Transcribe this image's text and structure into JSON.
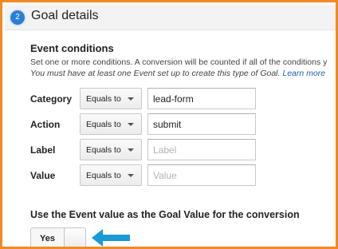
{
  "header": {
    "step_number": "2",
    "title": "Goal details"
  },
  "event_conditions": {
    "title": "Event conditions",
    "description": "Set one or more conditions. A conversion will be counted if all of the conditions y",
    "requirement": "You must have at least one Event set up to create this type of Goal.",
    "learn_more": "Learn more"
  },
  "conditions": [
    {
      "label": "Category",
      "operator": "Equals to",
      "value": "lead-form",
      "placeholder": ""
    },
    {
      "label": "Action",
      "operator": "Equals to",
      "value": "submit",
      "placeholder": ""
    },
    {
      "label": "Label",
      "operator": "Equals to",
      "value": "",
      "placeholder": "Label"
    },
    {
      "label": "Value",
      "operator": "Equals to",
      "value": "",
      "placeholder": "Value"
    }
  ],
  "goal_value": {
    "label": "Use the Event value as the Goal Value for the conversion",
    "toggle_label": "Yes"
  },
  "colors": {
    "frame_border": "#f08a24",
    "step_badge": "#2a7fd4",
    "arrow": "#1a9ad6",
    "link": "#1a5fb4"
  },
  "icons": {
    "operator_caret": "chevron-down-icon",
    "pointer": "arrow-left-icon"
  }
}
